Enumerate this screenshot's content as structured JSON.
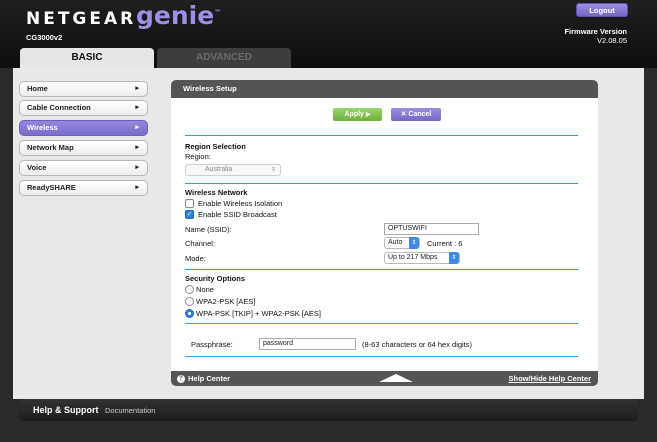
{
  "header": {
    "brand": "NETGEAR",
    "product": "genie",
    "trademark": "™",
    "model": "CG3000v2",
    "logout_label": "Logout",
    "firmware_label": "Firmware Version",
    "firmware_value": "V2.08.05"
  },
  "tabs": [
    {
      "label": "BASIC",
      "active": true
    },
    {
      "label": "ADVANCED",
      "active": false
    }
  ],
  "sidebar": {
    "items": [
      {
        "label": "Home",
        "active": false
      },
      {
        "label": "Cable Connection",
        "active": false
      },
      {
        "label": "Wireless",
        "active": true
      },
      {
        "label": "Network Map",
        "active": false
      },
      {
        "label": "Voice",
        "active": false
      },
      {
        "label": "ReadySHARE",
        "active": false
      }
    ],
    "arrow": "▸"
  },
  "panel": {
    "title": "Wireless Setup",
    "apply_label": "Apply",
    "apply_icon": "▶",
    "cancel_label": "Cancel",
    "cancel_icon": "✕",
    "region": {
      "heading": "Region Selection",
      "label": "Region:",
      "value": "Australia"
    },
    "wireless": {
      "heading": "Wireless Network",
      "isolation_label": "Enable Wireless Isolation",
      "isolation_checked": false,
      "ssid_broadcast_label": "Enable SSID Broadcast",
      "ssid_broadcast_checked": true,
      "ssid_label": "Name (SSID):",
      "ssid_value": "OPTUSWIFI",
      "channel_label": "Channel:",
      "channel_value": "Auto",
      "current_channel": "Current : 6",
      "mode_label": "Mode:",
      "mode_value": "Up to 217 Mbps"
    },
    "security": {
      "heading": "Security Options",
      "options": [
        {
          "label": "None",
          "selected": false
        },
        {
          "label": "WPA2-PSK [AES]",
          "selected": false
        },
        {
          "label": "WPA-PSK [TKIP] + WPA2-PSK [AES]",
          "selected": true
        }
      ],
      "passphrase_label": "Passphrase:",
      "passphrase_value": "password",
      "passphrase_hint": "(8-63 characters or 64 hex digits)"
    },
    "footer": {
      "help_center": "Help Center",
      "help_icon": "?",
      "show_hide": "Show/Hide Help Center"
    }
  },
  "bottom_bar": {
    "help_support": "Help & Support",
    "documentation": "Documentation"
  },
  "colors": {
    "accent_purple": "#7a6dcb",
    "apply_green": "#6cb23d",
    "rule_blue": "#2a9ad6"
  }
}
